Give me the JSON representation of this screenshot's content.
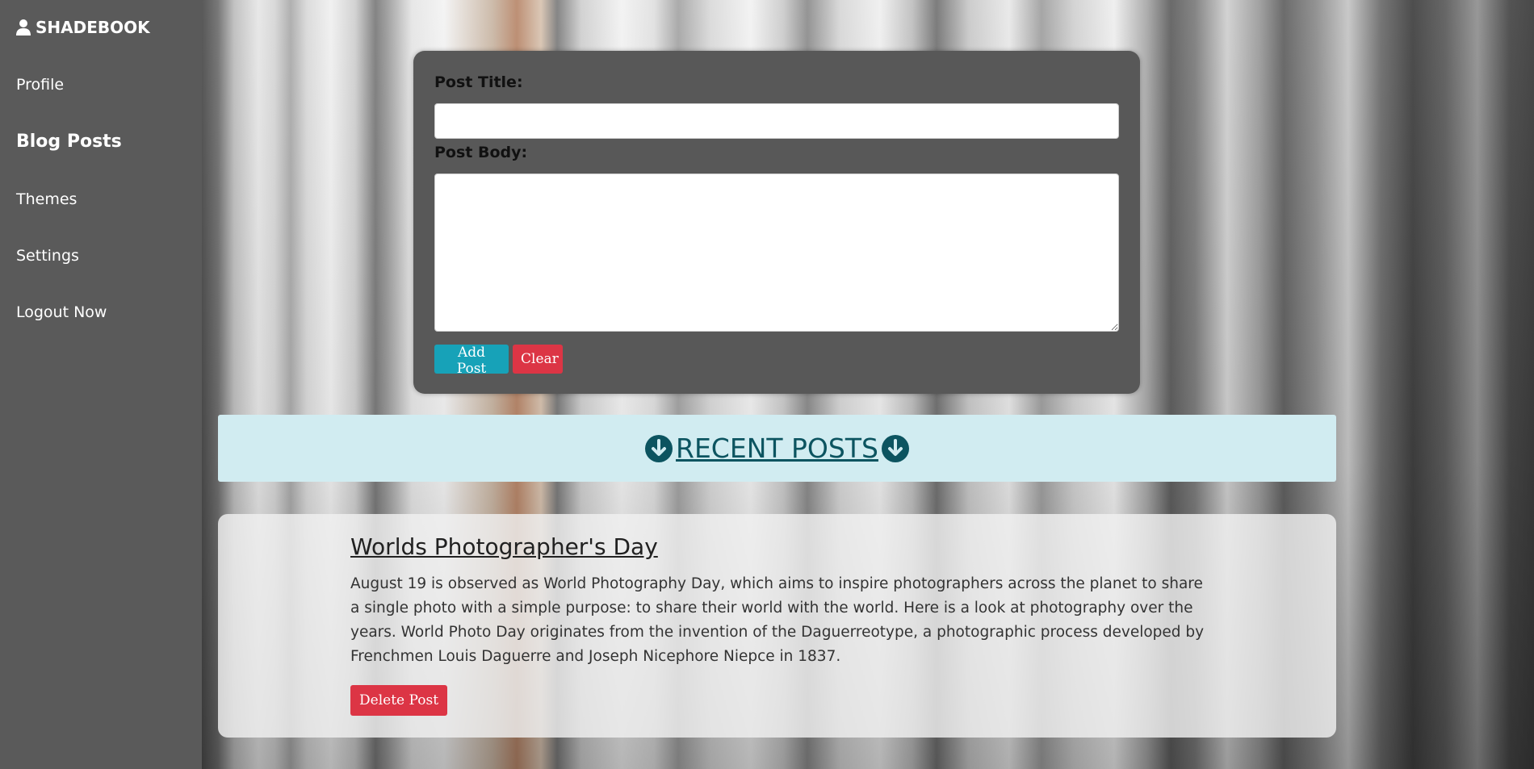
{
  "sidebar": {
    "brand": "SHADEBOOK",
    "items": [
      {
        "label": "Profile"
      },
      {
        "label": "Blog Posts"
      },
      {
        "label": "Themes"
      },
      {
        "label": "Settings"
      },
      {
        "label": "Logout Now"
      }
    ],
    "active_item": "Blog Posts"
  },
  "form": {
    "title_label": "Post Title:",
    "title_value": "",
    "body_label": "Post Body:",
    "body_value": "",
    "add_label": "Add Post",
    "clear_label": "Clear"
  },
  "recent": {
    "title": "RECENT POSTS",
    "icon": "arrow-circle-down-icon"
  },
  "posts": [
    {
      "title": "Worlds Photographer's Day",
      "body": "August 19 is observed as World Photography Day, which aims to inspire photographers across the planet to share a single photo with a simple purpose: to share their world with the world. Here is a look at photography over the years. World Photo Day originates from the invention of the Daguerreotype, a photographic process developed by Frenchmen Louis Daguerre and Joseph Nicephore Niepce in 1837.",
      "delete_label": "Delete Post"
    }
  ],
  "colors": {
    "sidebar_bg": "#5a5a5a",
    "form_bg": "#585858",
    "info_bg": "#d1ecf1",
    "info_text": "#0c5460",
    "add_button": "#17a2b8",
    "danger_button": "#dc3545"
  }
}
